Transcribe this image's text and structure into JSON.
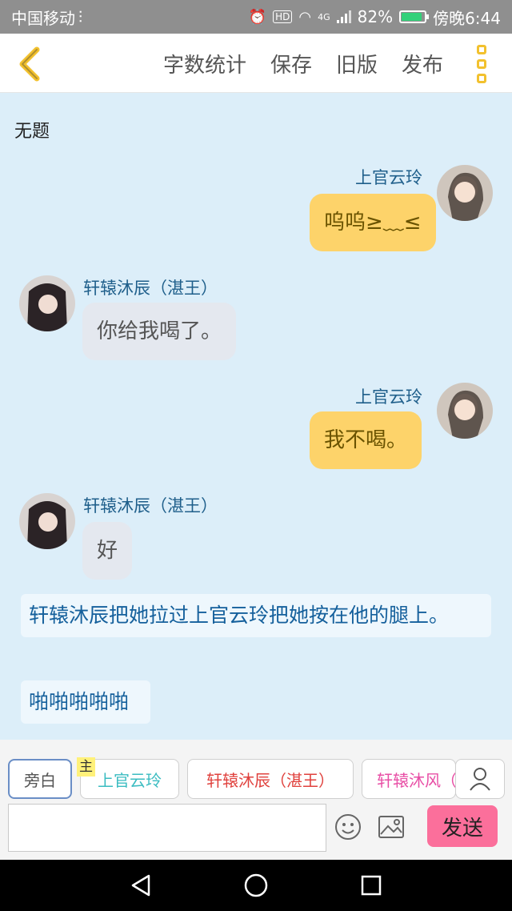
{
  "status_bar": {
    "carrier": "中国移动",
    "carrier_icon": "listen-icon",
    "hd_label": "HD",
    "network_label": "4G",
    "battery": "82%",
    "battery_level": 0.82,
    "time": "傍晚6:44"
  },
  "toolbar": {
    "back_icon": "chevron-left-icon",
    "actions": [
      "字数统计",
      "保存",
      "旧版",
      "发布"
    ],
    "more_icon": "more-vertical-icon",
    "accent_color": "#f2c12e"
  },
  "chat": {
    "title": "无题",
    "messages": [
      {
        "side": "right",
        "name": "上官云玲",
        "text": "呜呜≥﹏≤"
      },
      {
        "side": "left",
        "name": "轩辕沐辰（湛王）",
        "text": "你给我喝了。"
      },
      {
        "side": "right",
        "name": "上官云玲",
        "text": "我不喝。"
      },
      {
        "side": "left",
        "name": "轩辕沐辰（湛王）",
        "text": "好"
      }
    ],
    "narrations": [
      "轩辕沐辰把她拉过上官云玲把她按在他的腿上。",
      "啪啪啪啪啪"
    ]
  },
  "roles": {
    "narrator": "旁白",
    "main_tag": "主",
    "chars": [
      "上官云玲",
      "轩辕沐辰（湛王）",
      "轩辕沐风（"
    ],
    "char_colors": [
      "#3bbcc1",
      "#e0413d",
      "#e84ea5"
    ]
  },
  "composer": {
    "input_value": "",
    "send_label": "发送",
    "send_color": "#fb6f9b"
  }
}
